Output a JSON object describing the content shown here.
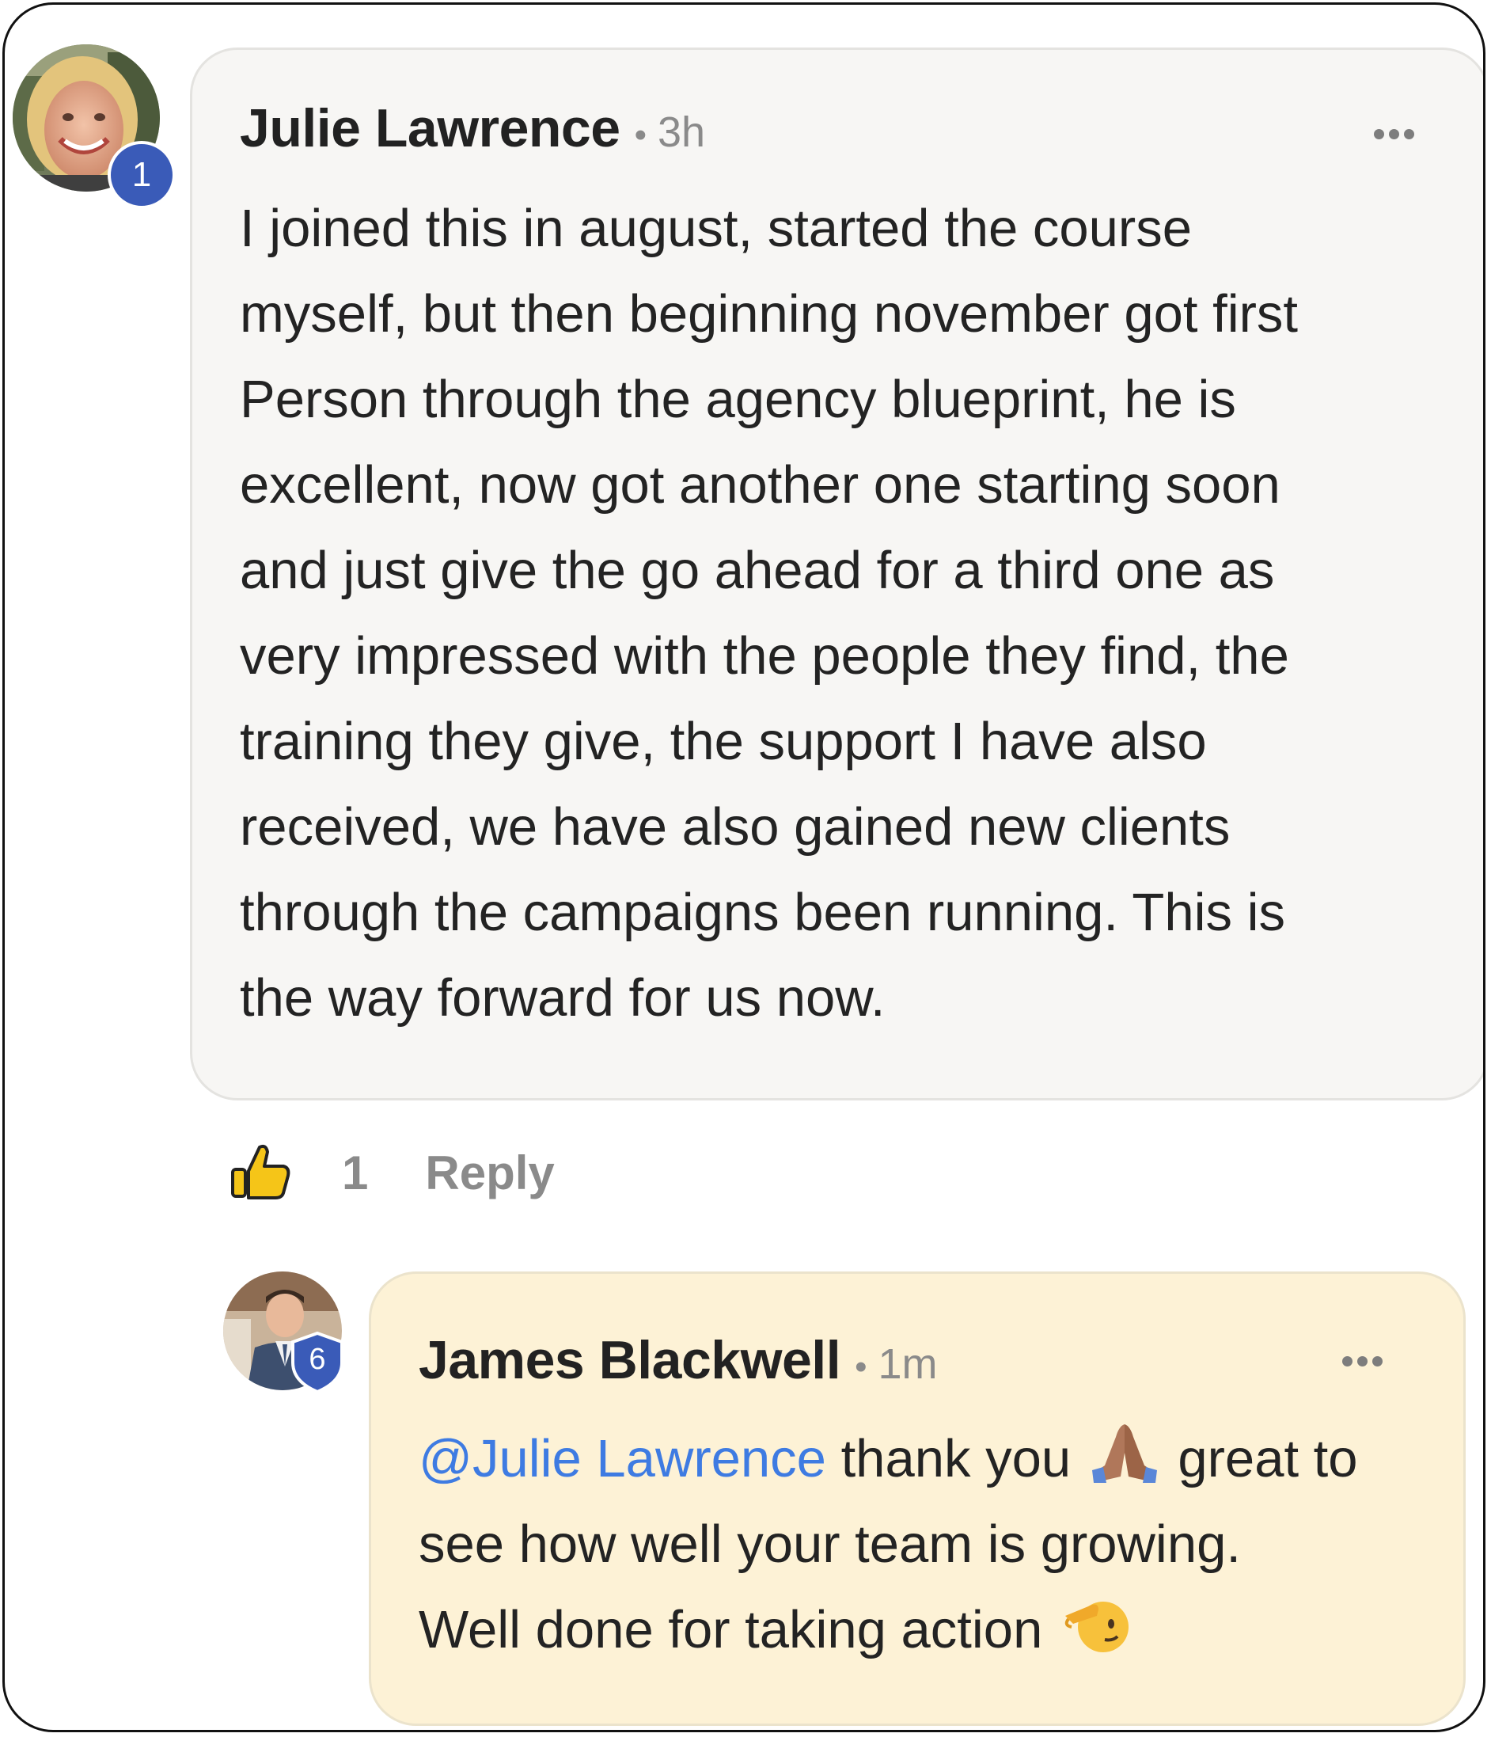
{
  "comment": {
    "author": "Julie Lawrence",
    "separator": "•",
    "time": "3h",
    "level": "1",
    "body_lines": [
      "I joined this in august, started the course",
      "myself, but then beginning november got first",
      "Person through the agency blueprint, he is",
      "excellent, now got another one starting soon",
      "and just give the go ahead for a third one as",
      "very impressed with the people they find, the",
      "training they give, the support I have also",
      "received, we have also gained new clients",
      "through the campaigns been running. This is",
      "the way forward for us now."
    ],
    "like_count": "1",
    "reply_label": "Reply"
  },
  "reply": {
    "author": "James Blackwell",
    "separator": "•",
    "time": "1m",
    "level": "6",
    "mention": "@Julie Lawrence",
    "line1_text": "thank you",
    "line1_emoji": "folded-hands-emoji",
    "line1_tail": "great to",
    "line2": "see how well your team is growing.",
    "line3_text": "Well done for taking action",
    "line3_emoji": "saluting-face-emoji"
  },
  "colors": {
    "mention": "#3e7be2",
    "reply_bubble": "#fdf2d6",
    "comment_bubble": "#f7f6f4",
    "level_badge": "#3a5bb8",
    "like_icon": "#f5c518"
  }
}
